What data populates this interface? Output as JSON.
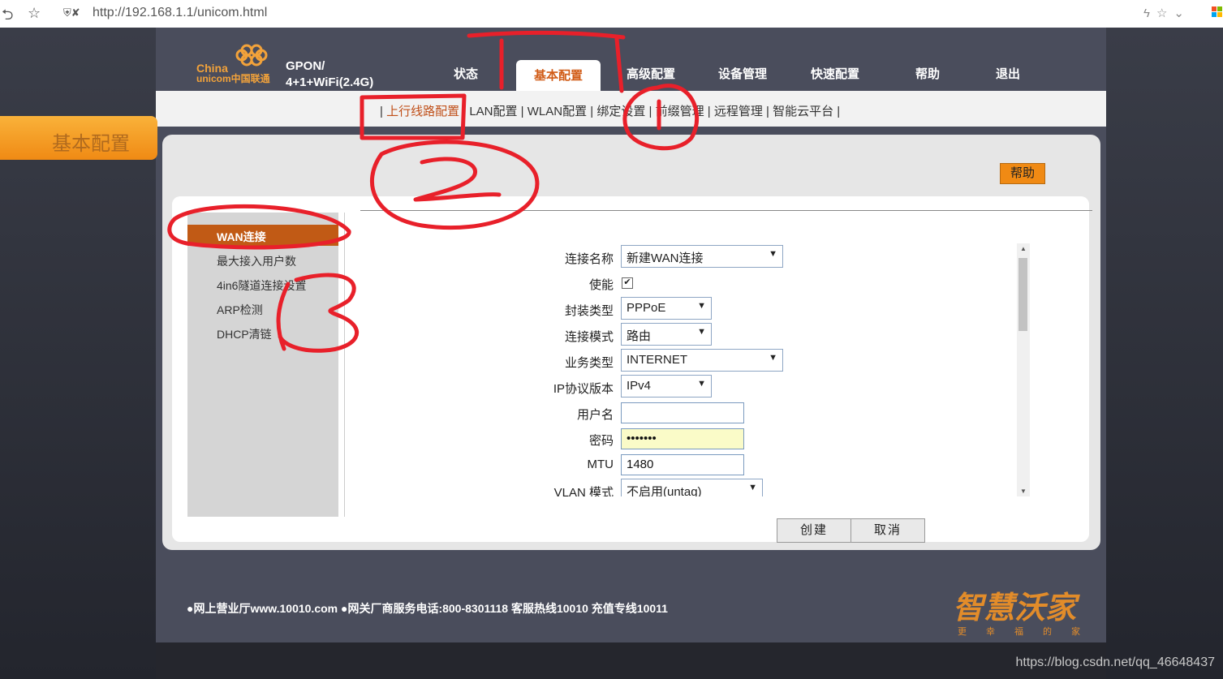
{
  "browser": {
    "url": "http://192.168.1.1/unicom.html",
    "watermark": "https://blog.csdn.net/qq_46648437"
  },
  "brand": {
    "logo_text_line1": "China",
    "logo_text_line2": "unicom中国联通",
    "model_line1": "GPON/",
    "model_line2": "4+1+WiFi(2.4G)"
  },
  "nav": [
    {
      "label": "状态"
    },
    {
      "label": "基本配置"
    },
    {
      "label": "高级配置"
    },
    {
      "label": "设备管理"
    },
    {
      "label": "快速配置"
    },
    {
      "label": "帮助"
    },
    {
      "label": "退出"
    }
  ],
  "subnav": {
    "items": [
      "上行线路配置",
      "LAN配置",
      "WLAN配置",
      "绑定设置",
      "前缀管理",
      "远程管理",
      "智能云平台"
    ],
    "separator": " | "
  },
  "panel": {
    "title": "基本配置",
    "help_label": "帮助"
  },
  "sidemenu": [
    "WAN连接",
    "最大接入用户数",
    "4in6隧道连接设置",
    "ARP检测",
    "DHCP清链"
  ],
  "form": {
    "connection_name_label": "连接名称",
    "connection_name_value": "新建WAN连接",
    "enable_label": "使能",
    "enable_checked": "✔",
    "encap_label": "封装类型",
    "encap_value": "PPPoE",
    "mode_label": "连接模式",
    "mode_value": "路由",
    "service_label": "业务类型",
    "service_value": "INTERNET",
    "ip_label": "IP协议版本",
    "ip_value": "IPv4",
    "username_label": "用户名",
    "username_value": "",
    "password_label": "密码",
    "password_value": "•••••••",
    "mtu_label": "MTU",
    "mtu_value": "1480",
    "vlan_label": "VLAN 模式",
    "vlan_value": "不启用(untag)"
  },
  "buttons": {
    "create": "创建",
    "cancel": "取消"
  },
  "footer": {
    "text": "●网上营业厅www.10010.com ●网关厂商服务电话:800-8301118 客服热线10010 充值专线10011",
    "brand": "智慧沃家",
    "brand_sub": "更幸福的家"
  }
}
